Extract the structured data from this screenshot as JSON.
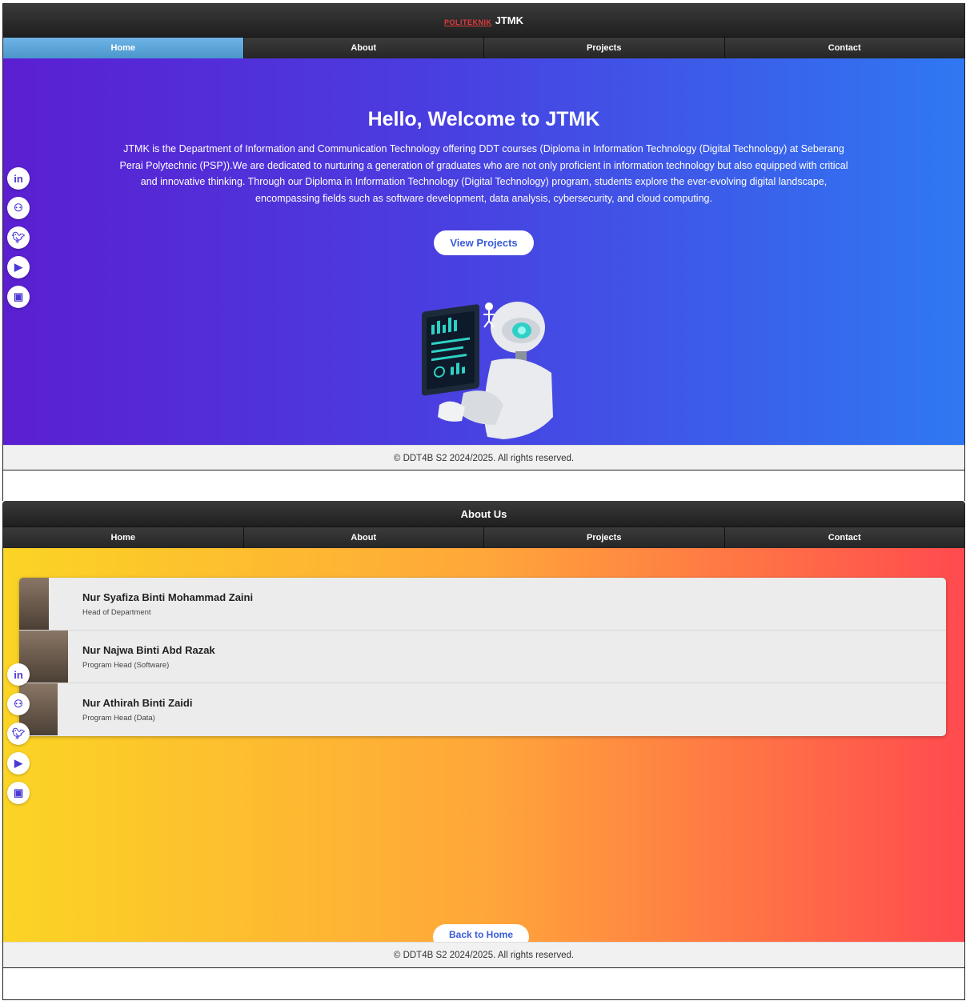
{
  "page1": {
    "logo_text": "POLITEKNIK",
    "header_title": "JTMK",
    "nav": [
      "Home",
      "About",
      "Projects",
      "Contact"
    ],
    "hero": {
      "title": "Hello, Welcome to JTMK",
      "description": "JTMK is the Department of Information and Communication Technology offering DDT courses (Diploma in Information Technology (Digital Technology) at Seberang Perai Polytechnic (PSP)).We are dedicated to nurturing a generation of graduates who are not only proficient in information technology but also equipped with critical and innovative thinking. Through our Diploma in Information Technology (Digital Technology) program, students explore the ever-evolving digital landscape, encompassing fields such as software development, data analysis, cybersecurity, and cloud computing.",
      "button": "View Projects"
    },
    "footer": "© DDT4B S2 2024/2025. All rights reserved."
  },
  "page2": {
    "header_title": "About Us",
    "nav": [
      "Home",
      "About",
      "Projects",
      "Contact"
    ],
    "members": [
      {
        "name": "Nur Syafiza Binti Mohammad Zaini",
        "role": "Head of Department"
      },
      {
        "name": "Nur Najwa Binti Abd Razak",
        "role": "Program Head (Software)"
      },
      {
        "name": "Nur Athirah Binti Zaidi",
        "role": "Program Head (Data)"
      }
    ],
    "back_button": "Back to Home",
    "footer": "© DDT4B S2 2024/2025. All rights reserved."
  },
  "social_icons": [
    "linkedin-icon",
    "github-icon",
    "twitter-icon",
    "youtube-icon",
    "instagram-icon"
  ],
  "colors": {
    "hero_start": "#5b1fd1",
    "hero_end": "#2f78f2",
    "about_start": "#fbd424",
    "about_end": "#ff4a4f",
    "nav_active": "#5aa5da"
  }
}
